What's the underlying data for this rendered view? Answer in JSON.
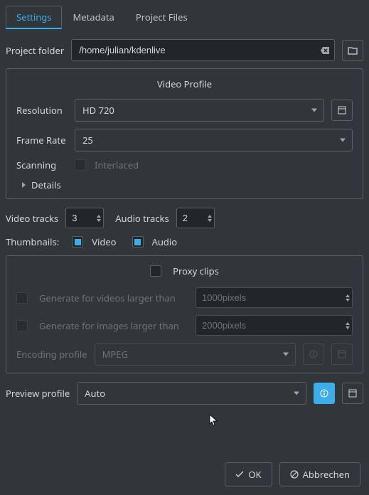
{
  "tabs": {
    "settings": "Settings",
    "metadata": "Metadata",
    "project_files": "Project Files"
  },
  "project_folder": {
    "label": "Project folder",
    "value": "/home/julian/kdenlive"
  },
  "video_profile": {
    "title": "Video Profile",
    "resolution_label": "Resolution",
    "resolution_value": "HD 720",
    "frame_rate_label": "Frame Rate",
    "frame_rate_value": "25",
    "scanning_label": "Scanning",
    "interlaced_label": "Interlaced",
    "details_label": "Details"
  },
  "tracks": {
    "video_label": "Video tracks",
    "video_value": "3",
    "audio_label": "Audio tracks",
    "audio_value": "2"
  },
  "thumbnails": {
    "label": "Thumbnails:",
    "video_label": "Video",
    "audio_label": "Audio"
  },
  "proxy": {
    "title": "Proxy clips",
    "gen_videos_label": "Generate for videos larger than",
    "gen_videos_value": "1000pixels",
    "gen_images_label": "Generate for images larger than",
    "gen_images_value": "2000pixels",
    "encoding_label": "Encoding profile",
    "encoding_value": "MPEG"
  },
  "preview": {
    "label": "Preview profile",
    "value": "Auto"
  },
  "buttons": {
    "ok": "OK",
    "cancel": "Abbrechen"
  }
}
